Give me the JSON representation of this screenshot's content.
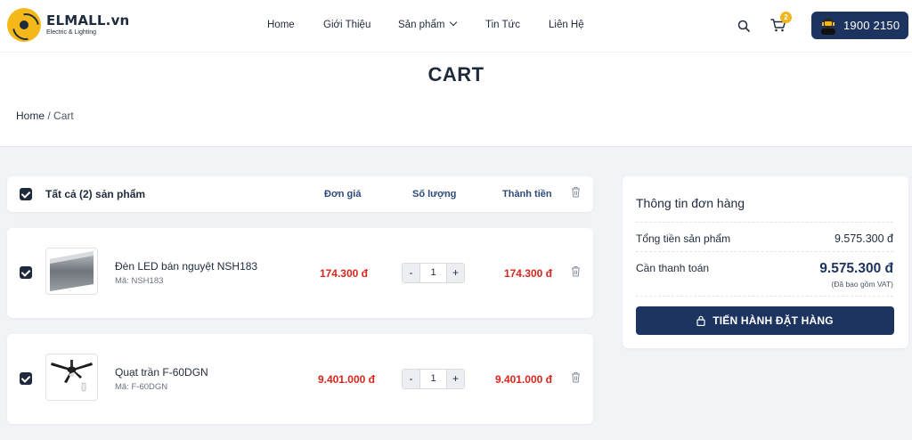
{
  "brand": {
    "name": "ELMALL",
    "suffix": ".vn",
    "tagline": "Electric & Lighting",
    "logo_icon": "lightbulb-logo"
  },
  "nav": {
    "items": [
      {
        "label": "Home"
      },
      {
        "label": "Giới Thiệu"
      },
      {
        "label": "Sản phẩm",
        "has_dropdown": true
      },
      {
        "label": "Tin Tức"
      },
      {
        "label": "Liên Hệ"
      }
    ],
    "search_icon": "search-icon",
    "cart_icon": "cart-icon",
    "cart_count": "2",
    "hotline": "1900 2150"
  },
  "page": {
    "title": "CART",
    "breadcrumb": {
      "home": "Home",
      "separator": "/",
      "current": "Cart"
    }
  },
  "cart": {
    "select_all_label": "Tất cả (2) sản phẩm",
    "columns": {
      "unit_price": "Đơn giá",
      "quantity": "Số lượng",
      "subtotal": "Thành tiền"
    },
    "items": [
      {
        "name": "Đèn LED bán nguyệt NSH183",
        "sku": "Mã: NSH183",
        "unit_price": "174.300 đ",
        "quantity": "1",
        "subtotal": "174.300 đ",
        "checked": true
      },
      {
        "name": "Quạt trần F-60DGN",
        "sku": "Mã: F-60DGN",
        "unit_price": "9.401.000 đ",
        "quantity": "1",
        "subtotal": "9.401.000 đ",
        "checked": true
      }
    ],
    "qty_minus": "-",
    "qty_plus": "+"
  },
  "summary": {
    "title": "Thông tin đơn hàng",
    "products_total_label": "Tổng tiền sản phẩm",
    "products_total_value": "9.575.300 đ",
    "to_pay_label": "Cần thanh toán",
    "to_pay_value": "9.575.300 đ",
    "vat_note": "(Đã bao gồm VAT)",
    "checkout_label": "TIẾN HÀNH ĐẶT HÀNG"
  },
  "colors": {
    "primary": "#1e3460",
    "accent": "#f5b819",
    "price": "#d7261c",
    "background": "#f1f3f6"
  }
}
